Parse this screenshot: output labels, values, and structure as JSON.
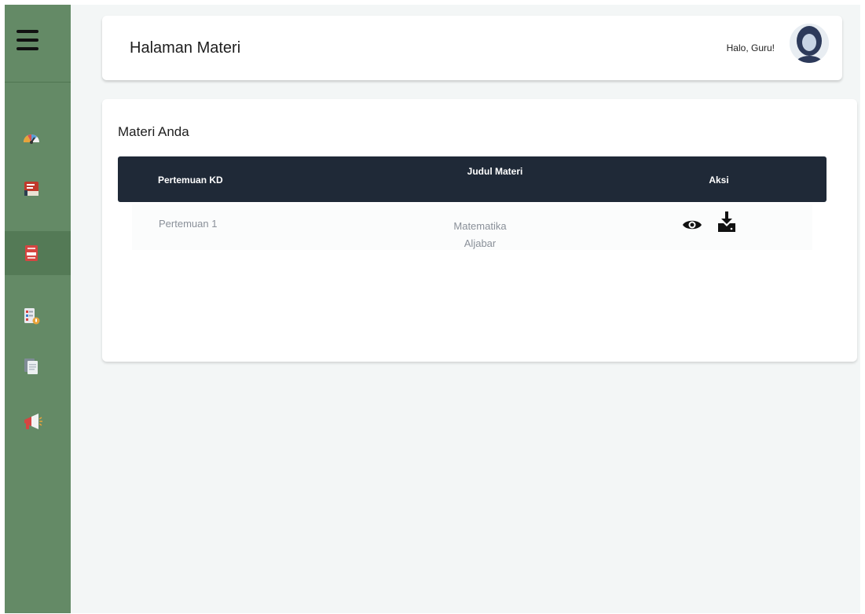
{
  "header": {
    "title": "Halaman Materi",
    "greeting": "Halo, Guru!"
  },
  "sidebar": {
    "menu_icon": "hamburger-menu-icon",
    "items": [
      {
        "icon": "dashboard-gauge-icon",
        "active": false
      },
      {
        "icon": "book-icon",
        "active": false
      },
      {
        "icon": "materi-document-icon",
        "active": true
      },
      {
        "icon": "quiz-checklist-icon",
        "active": false
      },
      {
        "icon": "files-icon",
        "active": false
      },
      {
        "icon": "announcement-megaphone-icon",
        "active": false
      }
    ]
  },
  "materi": {
    "section_title": "Materi Anda",
    "columns": [
      "Pertemuan KD",
      "Judul Materi",
      "Aksi"
    ],
    "rows": [
      {
        "pertemuan": "Pertemuan 1",
        "judul": "Matematika Aljabar",
        "actions": [
          "view-eye-icon",
          "download-icon"
        ]
      }
    ]
  },
  "colors": {
    "sidebar": "#648a66",
    "sidebar_active": "#547a56",
    "table_header": "#1f2937",
    "page_background": "#f3f6f6"
  }
}
